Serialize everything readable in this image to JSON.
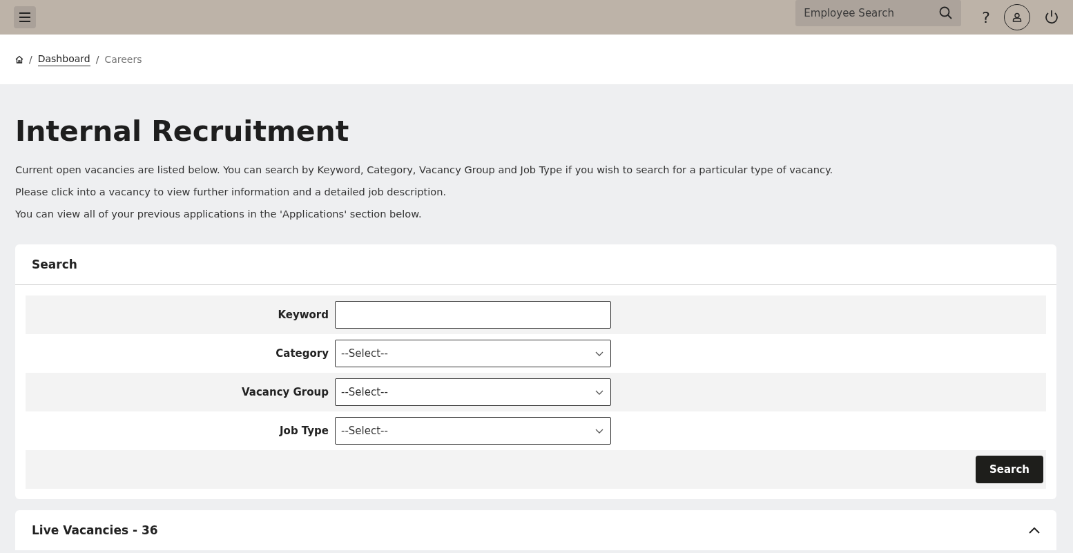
{
  "header": {
    "search": {
      "placeholder": "Employee Search"
    },
    "help": "?"
  },
  "breadcrumb": [
    {
      "separator": "/",
      "label": "Dashboard",
      "link": true
    },
    {
      "separator": "/",
      "label": "Careers",
      "link": false
    }
  ],
  "title": "Internal Recruitment",
  "intro": [
    "Current open vacancies are listed below. You can search by Keyword, Category, Vacancy Group and Job Type if you wish to search for a particular type of vacancy.",
    "Please click into a vacancy to view further information and a detailed job description.",
    "You can view all of your previous applications in the 'Applications' section below."
  ],
  "search_panel": {
    "title": "Search",
    "fields": [
      {
        "label": "Keyword",
        "kind": "text"
      },
      {
        "label": "Category",
        "kind": "select",
        "value": "--Select--"
      },
      {
        "label": "Vacancy Group",
        "kind": "select",
        "value": "--Select--"
      },
      {
        "label": "Job Type",
        "kind": "select",
        "value": "--Select--"
      }
    ],
    "button": "Search"
  },
  "vacancies_panel": {
    "title": "Live Vacancies - 36",
    "expanded": true
  }
}
